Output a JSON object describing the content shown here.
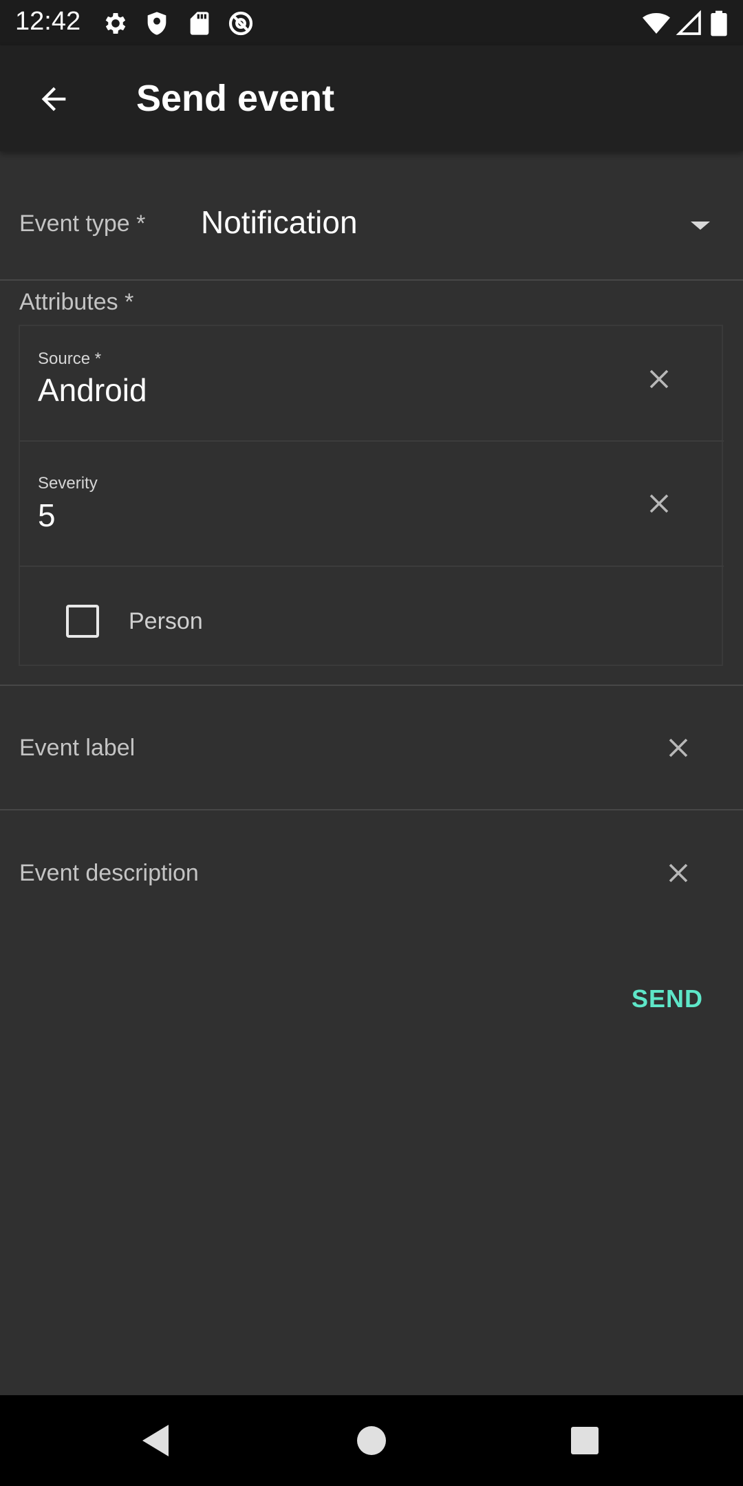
{
  "status_bar": {
    "time": "12:42",
    "icons": [
      "gear-icon",
      "shield-icon",
      "sd-card-icon",
      "at-sign-icon",
      "wifi-icon",
      "signal-icon",
      "battery-icon"
    ]
  },
  "app_bar": {
    "title": "Send event",
    "back_icon": "arrow-back-icon"
  },
  "form": {
    "event_type": {
      "label": "Event type *",
      "value": "Notification"
    },
    "attributes": {
      "label": "Attributes *",
      "source": {
        "caption": "Source *",
        "value": "Android"
      },
      "severity": {
        "caption": "Severity",
        "value": "5"
      },
      "person": {
        "label": "Person",
        "checked": false
      }
    },
    "event_label": {
      "label": "Event label"
    },
    "event_description": {
      "label": "Event description"
    },
    "send_label": "SEND"
  },
  "colors": {
    "background": "#303030",
    "app_bar": "#212121",
    "status_bar": "#1c1c1c",
    "accent": "#5ee6c8",
    "nav_bar": "#000000"
  },
  "nav_bar": {
    "icons": [
      "back-triangle-icon",
      "home-circle-icon",
      "recents-square-icon"
    ]
  }
}
